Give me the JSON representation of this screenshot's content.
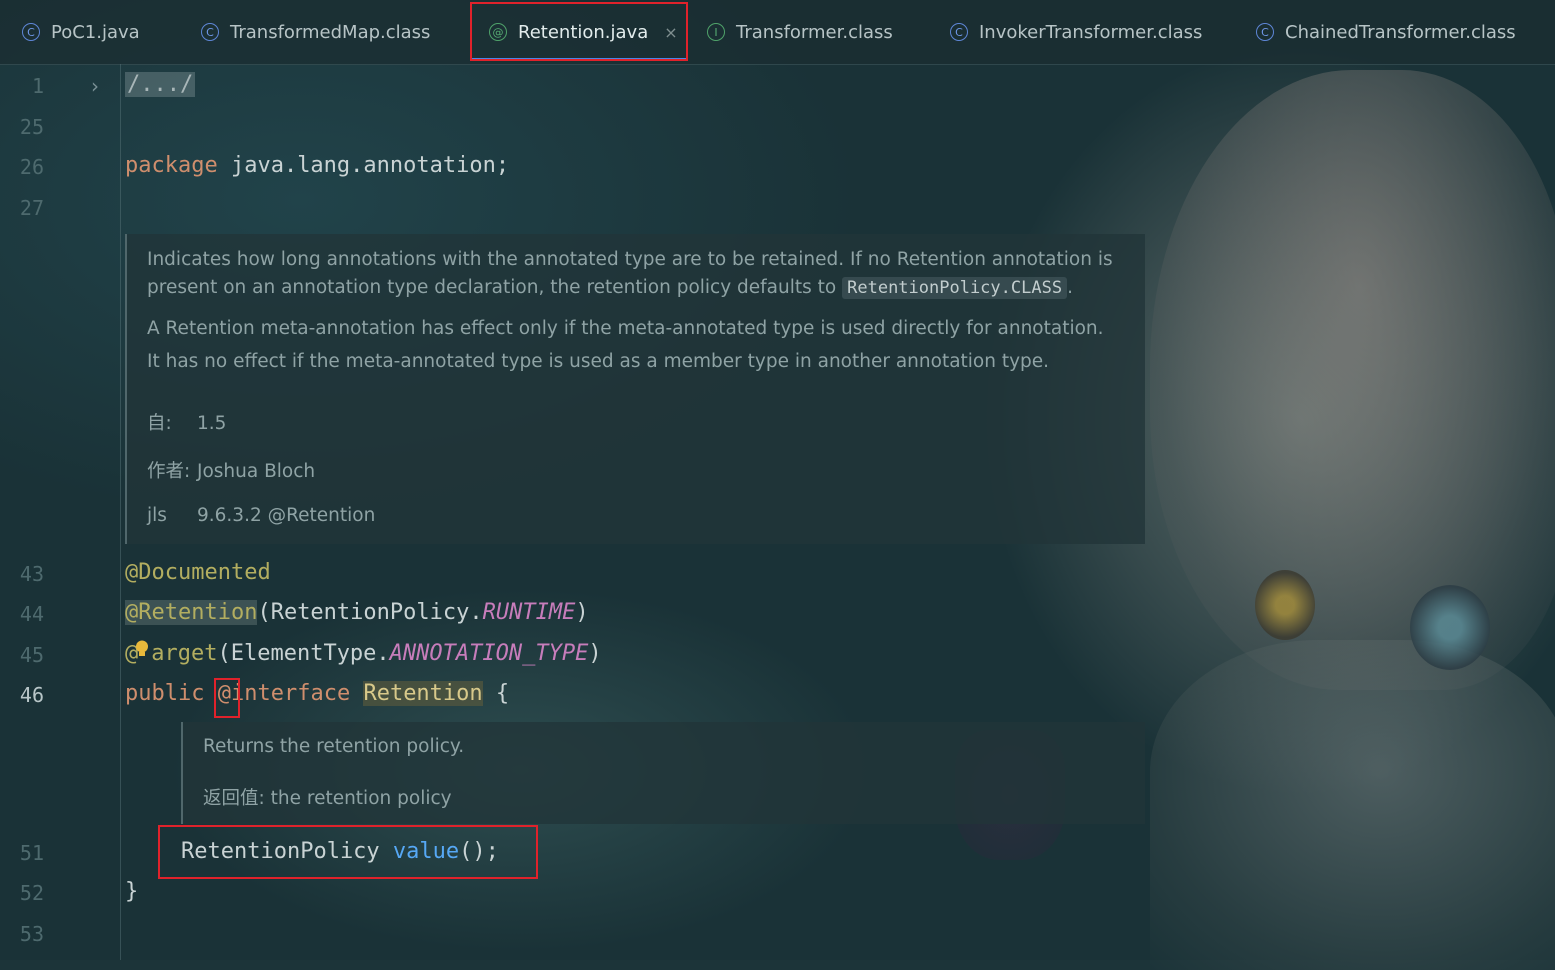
{
  "tabs": [
    {
      "label": "PoC1.java",
      "icon": "class-icon"
    },
    {
      "label": "TransformedMap.class",
      "icon": "class-icon"
    },
    {
      "label": "Retention.java",
      "icon": "annotation-icon",
      "active": true,
      "close": "×"
    },
    {
      "label": "Transformer.class",
      "icon": "interface-icon"
    },
    {
      "label": "InvokerTransformer.class",
      "icon": "class-icon"
    },
    {
      "label": "ChainedTransformer.class",
      "icon": "class-icon"
    }
  ],
  "icon_glyphs": {
    "class": "C",
    "interface": "I",
    "annotation": "@"
  },
  "line_numbers": {
    "l1": "1",
    "l25": "25",
    "l26": "26",
    "l27": "27",
    "l43": "43",
    "l44": "44",
    "l45": "45",
    "l46": "46",
    "l51": "51",
    "l52": "52",
    "l53": "53"
  },
  "code": {
    "fold": "/.../",
    "package_kw": "package",
    "package_name": " java.lang.annotation;",
    "documented": "@Documented",
    "retention_ann": "@Retention",
    "retention_paren_open": "(RetentionPolicy.",
    "runtime": "RUNTIME",
    "paren_close": ")",
    "target_at": "@",
    "target_rest": "arget",
    "target_paren_open": "(ElementType.",
    "annotation_type": "ANNOTATION_TYPE",
    "public_kw": "public",
    "interface_at": "@",
    "interface_kw": "interface",
    "class_name": "Retention",
    "brace_open": " {",
    "value_type": "RetentionPolicy ",
    "value_method": "value",
    "value_tail": "();",
    "brace_close": "}"
  },
  "doc1": {
    "p1_line1": "Indicates how long annotations with the annotated type are to be retained. If no Retention annotation is",
    "p1_line2_pre": "present on an annotation type declaration, the retention policy defaults to ",
    "p1_line2_code": "RetentionPolicy.CLASS",
    "p1_line2_post": ".",
    "p2_line1": "A Retention meta-annotation has effect only if the meta-annotated type is used directly for annotation.",
    "p2_line2": "It has no effect if the meta-annotated type is used as a member type in another annotation type.",
    "since_label": "自:",
    "since_value": "1.5",
    "author_label": "作者:",
    "author_value": "Joshua Bloch",
    "jls_label": "jls",
    "jls_value": "9.6.3.2 @Retention"
  },
  "doc2": {
    "line1": "Returns the retention policy.",
    "returns_label": "返回值:",
    "returns_value": "the retention policy"
  }
}
